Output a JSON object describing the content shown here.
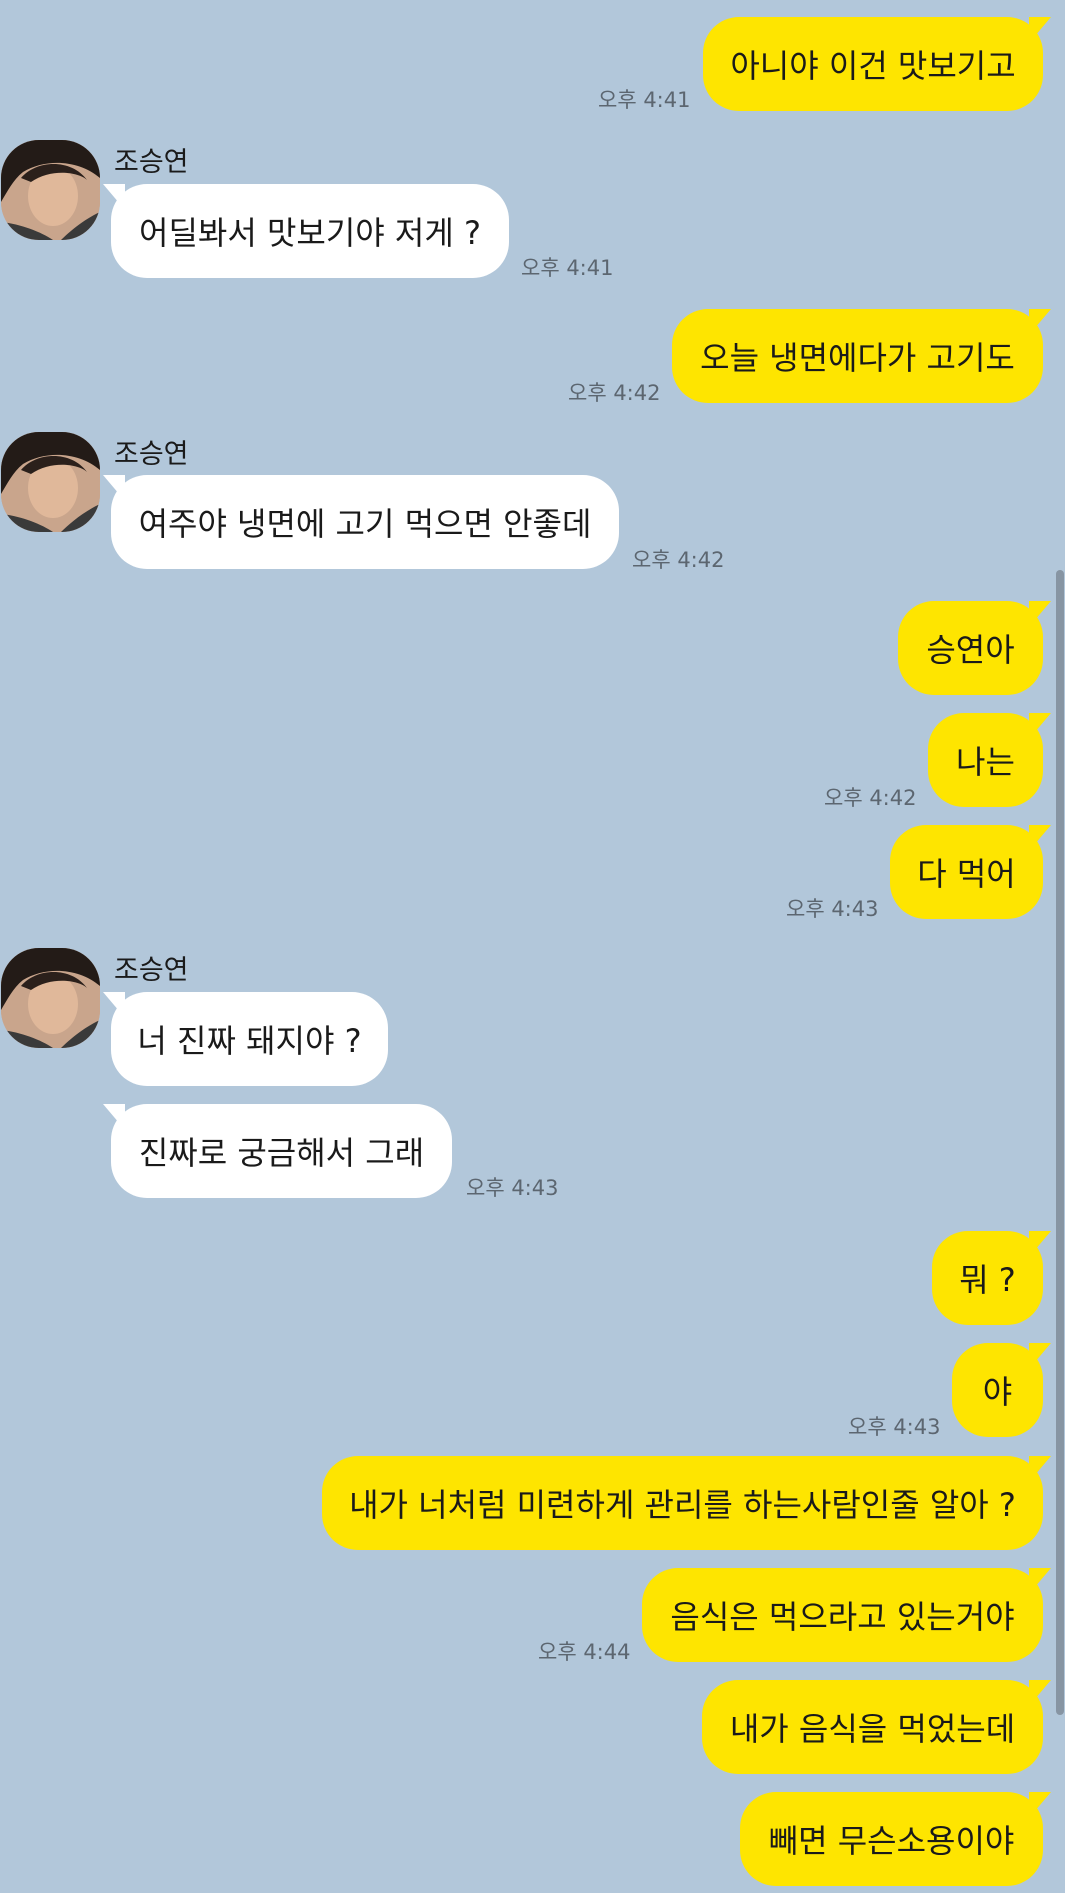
{
  "chat": {
    "sender_name": "조승연",
    "messages": [
      {
        "text": "아니야 이건 맛보기고",
        "time": "오후 4:41"
      },
      {
        "text": "어딜봐서 맛보기야 저게 ?",
        "time": "오후 4:41"
      },
      {
        "text": "오늘 냉면에다가 고기도",
        "time": "오후 4:42"
      },
      {
        "text": "여주야 냉면에 고기 먹으면 안좋데",
        "time": "오후 4:42"
      },
      {
        "text": "승연아"
      },
      {
        "text": "나는",
        "time": "오후 4:42"
      },
      {
        "text": "다 먹어",
        "time": "오후 4:43"
      },
      {
        "text": "너 진짜 돼지야 ?"
      },
      {
        "text": "진짜로 궁금해서 그래",
        "time": "오후 4:43"
      },
      {
        "text": "뭐 ?"
      },
      {
        "text": "야",
        "time": "오후 4:43"
      },
      {
        "text": "내가 너처럼 미련하게 관리를 하는사람인줄 알아 ?"
      },
      {
        "text": "음식은 먹으라고 있는거야",
        "time": "오후 4:44"
      },
      {
        "text": "내가 음식을 먹었는데"
      },
      {
        "text": "빼면 무슨소용이야"
      }
    ]
  },
  "colors": {
    "background": "#b2c7da",
    "my_bubble": "#fee500",
    "other_bubble": "#ffffff",
    "timestamp": "#5c6670"
  }
}
